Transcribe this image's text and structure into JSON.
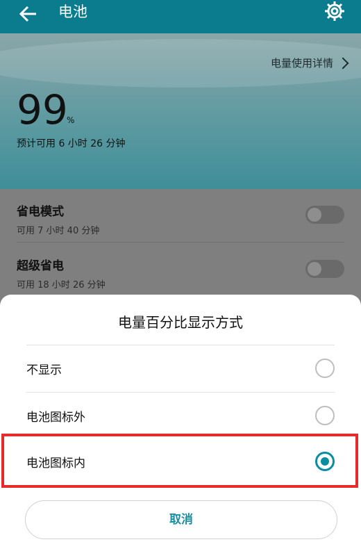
{
  "appbar": {
    "title": "电池"
  },
  "hero": {
    "detail_link": "电量使用详情",
    "percent": "99",
    "percent_unit": "%",
    "estimate": "预计可用 6 小时 26 分钟"
  },
  "list": {
    "items": [
      {
        "title": "省电模式",
        "subtitle": "可用 7 小时 40 分钟",
        "enabled": false
      },
      {
        "title": "超级省电",
        "subtitle": "可用 18 小时 26 分钟",
        "enabled": false
      }
    ]
  },
  "sheet": {
    "title": "电量百分比显示方式",
    "options": [
      {
        "label": "不显示",
        "selected": false
      },
      {
        "label": "电池图标外",
        "selected": false
      },
      {
        "label": "电池图标内",
        "selected": true
      }
    ],
    "cancel_label": "取消"
  },
  "colors": {
    "appbar": "#0b7c8e",
    "accent": "#0b8da0",
    "highlight": "#e62b2b"
  }
}
